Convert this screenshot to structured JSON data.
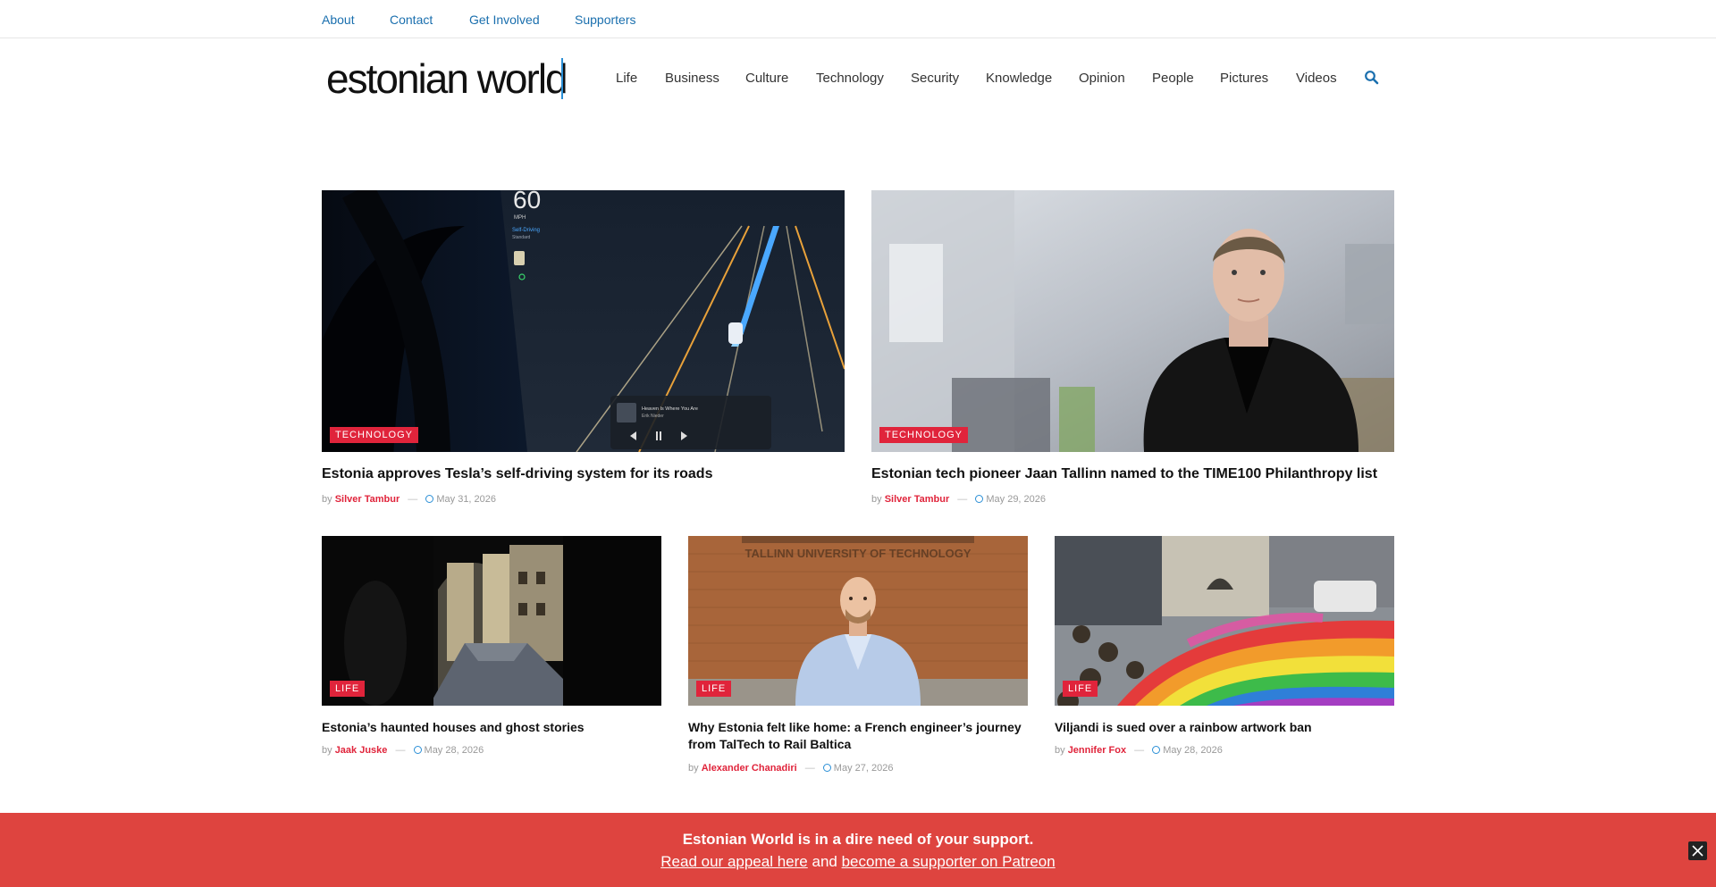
{
  "topbar": {
    "links": [
      "About",
      "Contact",
      "Get Involved",
      "Supporters"
    ]
  },
  "header": {
    "logo": "estonian world",
    "nav": [
      "Life",
      "Business",
      "Culture",
      "Technology",
      "Security",
      "Knowledge",
      "Opinion",
      "People",
      "Pictures",
      "Videos"
    ],
    "search_icon": "search-icon"
  },
  "articles": [
    {
      "category": "TECHNOLOGY",
      "title": "Estonia approves Tesla’s self-driving system for its roads",
      "by": "by",
      "author": "Silver Tambur",
      "sep": "—",
      "date": "May 31, 2026"
    },
    {
      "category": "TECHNOLOGY",
      "title": "Estonian tech pioneer Jaan Tallinn named to the TIME100 Philanthropy list",
      "by": "by",
      "author": "Silver Tambur",
      "sep": "—",
      "date": "May 29, 2026"
    },
    {
      "category": "LIFE",
      "title": "Estonia’s haunted houses and ghost stories",
      "by": "by",
      "author": "Jaak Juske",
      "sep": "—",
      "date": "May 28, 2026"
    },
    {
      "category": "LIFE",
      "title": "Why Estonia felt like home: a French engineer’s journey from TalTech to Rail Baltica",
      "by": "by",
      "author": "Alexander Chanadiri",
      "sep": "—",
      "date": "May 27, 2026"
    },
    {
      "category": "LIFE",
      "title": "Viljandi is sued over a rainbow artwork ban",
      "by": "by",
      "author": "Jennifer Fox",
      "sep": "—",
      "date": "May 28, 2026"
    }
  ],
  "image_text": {
    "speed": "60",
    "mph": "MPH",
    "self_driving": "Self-Driving",
    "standard": "Standard",
    "song": "Heaven Is Where You Are",
    "artist": "Erik Nieder",
    "building_sign": "TALLINN UNIVERSITY OF TECHNOLOGY"
  },
  "banner": {
    "headline": "Estonian World is in a dire need of your support.",
    "link1": "Read our appeal here",
    "and": "and",
    "link2": "become a supporter on Patreon"
  },
  "colors": {
    "accent_red": "#e0243b",
    "link_blue": "#1a6fae",
    "banner_bg": "#de443f"
  }
}
